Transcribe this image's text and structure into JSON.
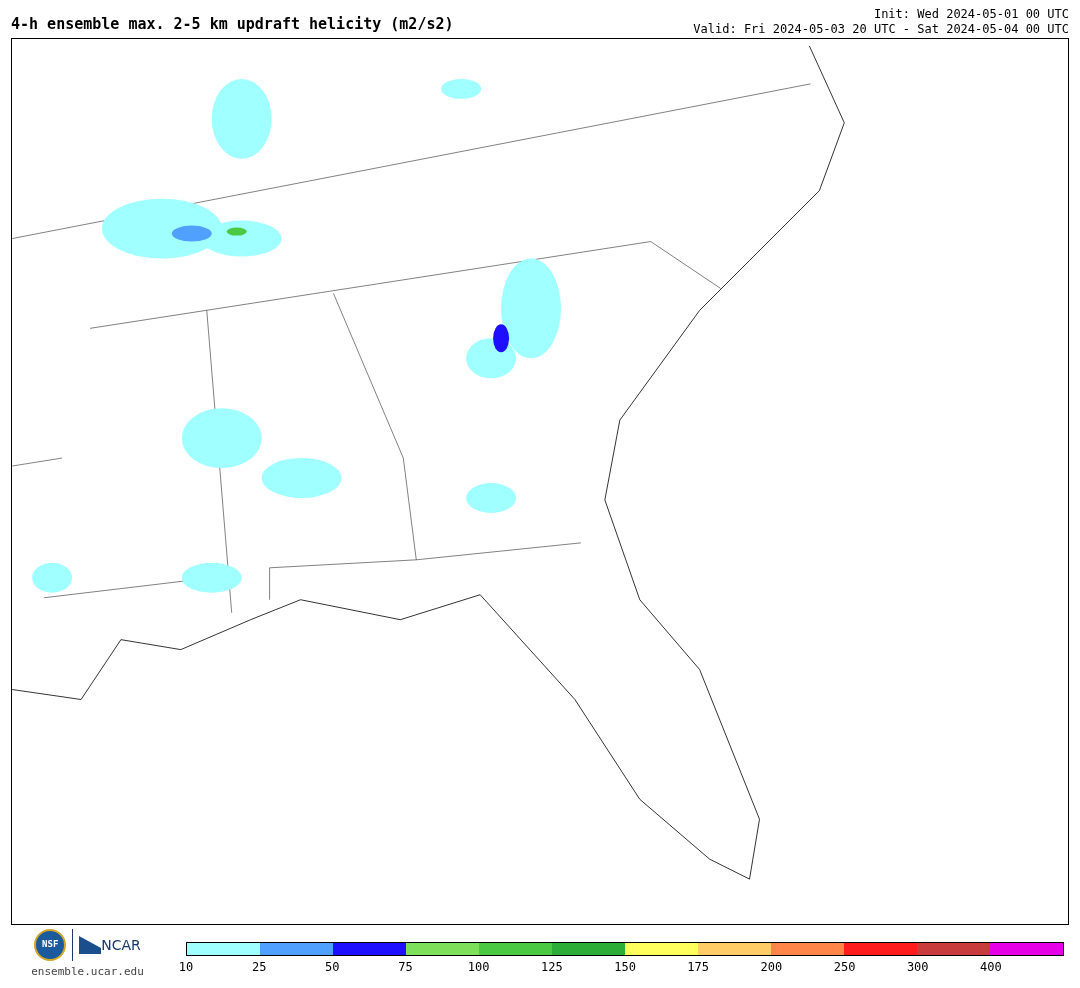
{
  "title": "4-h ensemble max. 2-5 km updraft helicity (m2/s2)",
  "init": "Init: Wed 2024-05-01 00 UTC",
  "valid": "Valid: Fri 2024-05-03 20 UTC - Sat 2024-05-04 00 UTC",
  "logos": {
    "nsf": "NSF",
    "ncar": "NCAR",
    "site": "ensemble.ucar.edu"
  },
  "legend": [
    {
      "label": "10",
      "color": "#a0ffff"
    },
    {
      "label": "25",
      "color": "#50a0ff"
    },
    {
      "label": "50",
      "color": "#1e10ff"
    },
    {
      "label": "75",
      "color": "#7ee05a"
    },
    {
      "label": "100",
      "color": "#4cc942"
    },
    {
      "label": "125",
      "color": "#2bad38"
    },
    {
      "label": "150",
      "color": "#ffff5e"
    },
    {
      "label": "175",
      "color": "#ffcc66"
    },
    {
      "label": "200",
      "color": "#ff8648"
    },
    {
      "label": "250",
      "color": "#ff1c1c"
    },
    {
      "label": "300",
      "color": "#c83c3c"
    },
    {
      "label": "400",
      "color": "#e600e6"
    }
  ]
}
